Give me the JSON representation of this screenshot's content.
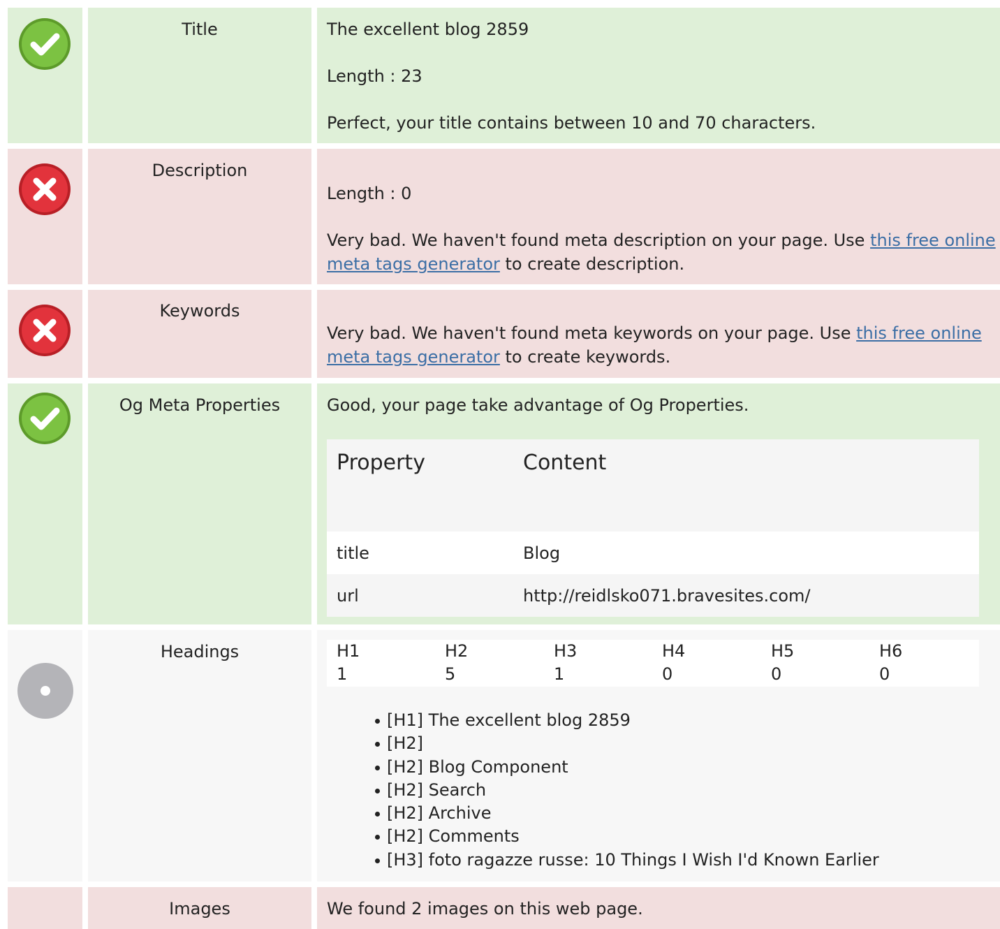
{
  "colors": {
    "good_row": "#dff0d8",
    "bad_row": "#f2dede",
    "info_row": "#f7f7f7",
    "good_icon": "#7cc242",
    "bad_icon": "#e2333c",
    "info_icon": "#b4b4b8",
    "link": "#3b6ea5"
  },
  "title_row": {
    "status_icon": "check-circle-icon",
    "label": "Title",
    "value": "The excellent blog 2859",
    "length": "Length : 23",
    "message": "Perfect, your title contains between 10 and 70 characters."
  },
  "description_row": {
    "status_icon": "x-circle-icon",
    "label": "Description",
    "length": "Length : 0",
    "message_before": "Very bad. We haven't found meta description on your page. Use ",
    "link_text": "this free online meta tags generator",
    "message_after": " to create description."
  },
  "keywords_row": {
    "status_icon": "x-circle-icon",
    "label": "Keywords",
    "message_before": "Very bad. We haven't found meta keywords on your page. Use ",
    "link_text": "this free online meta tags generator",
    "message_after": " to create keywords."
  },
  "og_row": {
    "status_icon": "check-circle-icon",
    "label": "Og Meta Properties",
    "message": "Good, your page take advantage of Og Properties.",
    "table": {
      "headers": {
        "property": "Property",
        "content": "Content"
      },
      "rows": [
        {
          "property": "title",
          "content": "Blog"
        },
        {
          "property": "url",
          "content": "http://reidlsko071.bravesites.com/"
        }
      ]
    }
  },
  "headings_row": {
    "status_icon": "info-circle-icon",
    "label": "Headings",
    "counts": [
      {
        "tag": "H1",
        "count": "1"
      },
      {
        "tag": "H2",
        "count": "5"
      },
      {
        "tag": "H3",
        "count": "1"
      },
      {
        "tag": "H4",
        "count": "0"
      },
      {
        "tag": "H5",
        "count": "0"
      },
      {
        "tag": "H6",
        "count": "0"
      }
    ],
    "list": [
      "[H1] The excellent blog 2859",
      "[H2]",
      "[H2] Blog Component",
      "[H2] Search",
      "[H2] Archive",
      "[H2] Comments",
      "[H3] foto ragazze russe: 10 Things I Wish I'd Known Earlier"
    ]
  },
  "images_row": {
    "label": "Images",
    "message": "We found 2 images on this web page."
  }
}
